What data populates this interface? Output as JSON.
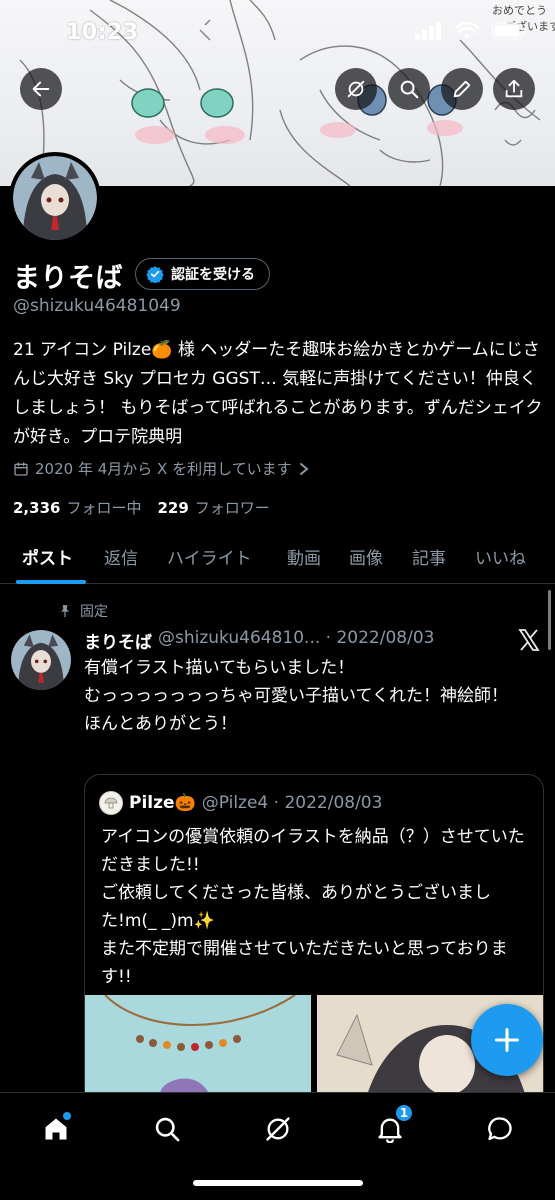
{
  "status": {
    "time": "10:23"
  },
  "banner": {
    "scribble_a": "おめでとう",
    "scribble_b": "ございます"
  },
  "header_buttons": {
    "back": "back-arrow-icon",
    "grok": "grok-icon",
    "search": "search-icon",
    "edit": "pencil-icon",
    "share": "share-icon"
  },
  "profile": {
    "name": "まりそば",
    "verify_label": "認証を受ける",
    "handle": "@shizuku46481049",
    "bio": "21 アイコン Pilze🍊 様 ヘッダーたそ趣味お絵かきとかゲームにじさんじ大好き Sky プロセカ GGST… 気軽に声掛けてください！仲良くしましょう！ もりそばって呼ばれることがあります。ずんだシェイクが好き。プロテ院典明",
    "joined": "2020 年 4月から X を利用しています",
    "following_count": "2,336",
    "following_label": "フォロー中",
    "followers_count": "229",
    "followers_label": "フォロワー"
  },
  "tabs": [
    {
      "label": "ポスト",
      "active": true
    },
    {
      "label": "返信"
    },
    {
      "label": "ハイライト"
    },
    {
      "label": "動画"
    },
    {
      "label": "画像"
    },
    {
      "label": "記事"
    },
    {
      "label": "いいね"
    }
  ],
  "tweet": {
    "pinned_label": "固定",
    "name": "まりそば",
    "handle_date": "@shizuku464810... · 2022/08/03",
    "text_lines": [
      "有償イラスト描いてもらいました！",
      "むっっっっっっっちゃ可愛い子描いてくれた！神絵師！",
      "ほんとありがとう！"
    ]
  },
  "quote": {
    "name": "Pilze🎃",
    "handle_date": "@Pilze4 · 2022/08/03",
    "text_lines": [
      "アイコンの優賞依頼のイラストを納品（？）させていただきました!!",
      "ご依頼してくださった皆様、ありがとうございました!m(_ _)m✨",
      "また不定期で開催させていただきたいと思っております!!"
    ]
  },
  "notifications_badge": "1",
  "colors": {
    "accent": "#1d9bf0",
    "background": "#000000",
    "muted": "#8b98a5"
  }
}
